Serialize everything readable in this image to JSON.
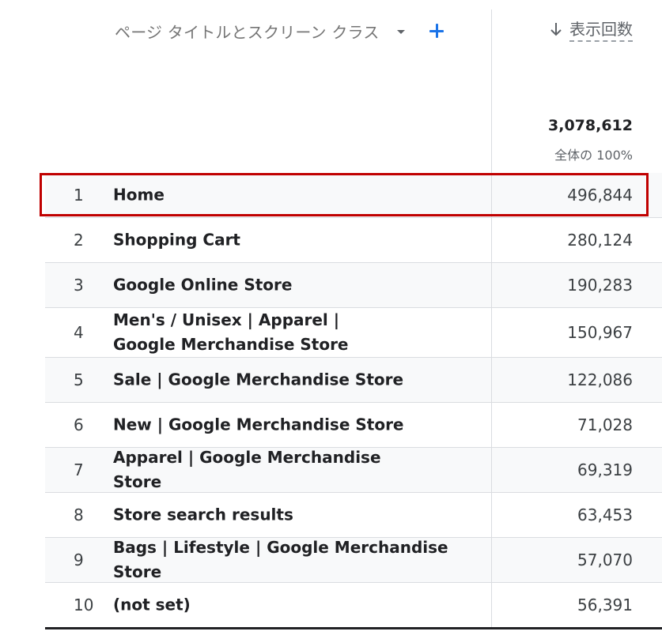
{
  "table": {
    "dimension_header": "ページ タイトルとスクリーン クラス",
    "metric_header": "表示回数",
    "sort_icon": "arrow-down-icon",
    "dropdown_icon": "caret-down-icon",
    "add_icon": "plus-icon",
    "total_value": "3,078,612",
    "total_pct": "全体の 100%",
    "rows": [
      {
        "rank": "1",
        "name": "Home",
        "value": "496,844"
      },
      {
        "rank": "2",
        "name": "Shopping Cart",
        "value": "280,124"
      },
      {
        "rank": "3",
        "name": "Google Online Store",
        "value": "190,283"
      },
      {
        "rank": "4",
        "name": "Men's / Unisex | Apparel | Google Merchandise Store",
        "value": "150,967"
      },
      {
        "rank": "5",
        "name": "Sale | Google Merchandise Store",
        "value": "122,086"
      },
      {
        "rank": "6",
        "name": "New | Google Merchandise Store",
        "value": "71,028"
      },
      {
        "rank": "7",
        "name": "Apparel | Google Merchandise Store",
        "value": "69,319"
      },
      {
        "rank": "8",
        "name": "Store search results",
        "value": "63,453"
      },
      {
        "rank": "9",
        "name": "Bags | Lifestyle | Google Merchandise Store",
        "value": "57,070"
      },
      {
        "rank": "10",
        "name": "(not set)",
        "value": "56,391"
      }
    ]
  },
  "colors": {
    "accent_blue": "#1a73e8",
    "highlight_red": "#c00000",
    "row_alt_bg": "#f8f9fa",
    "divider": "#dadce0"
  }
}
